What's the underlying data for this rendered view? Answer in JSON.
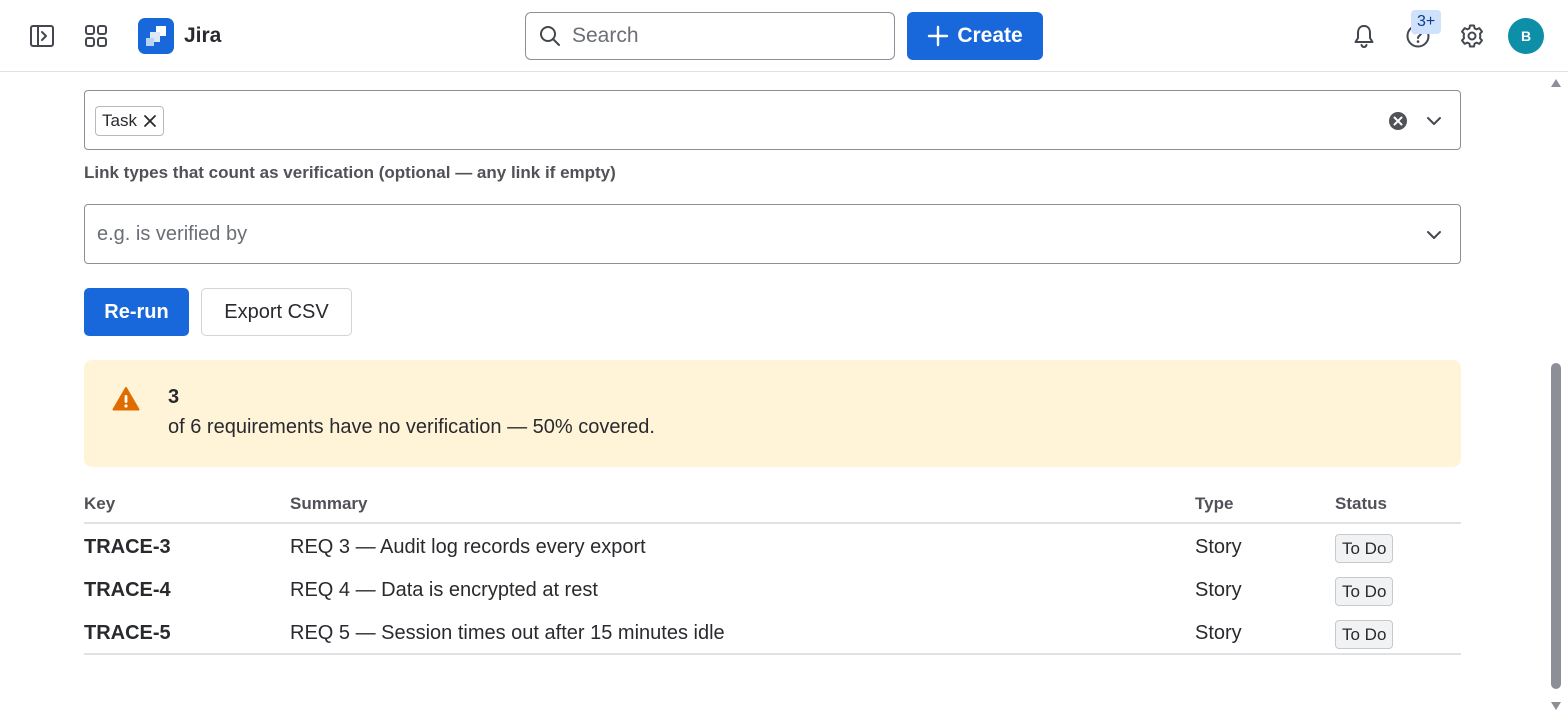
{
  "topbar": {
    "app_name": "Jira",
    "search_placeholder": "Search",
    "create_label": "Create",
    "help_badge": "3+",
    "avatar_initial": "B"
  },
  "issue_types_field": {
    "selected_tags": [
      {
        "label": "Task"
      }
    ]
  },
  "link_types_field": {
    "label": "Link types that count as verification (optional — any link if empty)",
    "placeholder": "e.g. is verified by",
    "value": ""
  },
  "actions": {
    "rerun_label": "Re-run",
    "export_label": "Export CSV"
  },
  "alert": {
    "count": "3",
    "message": "of 6 requirements have no verification — 50% covered."
  },
  "table": {
    "headers": {
      "key": "Key",
      "summary": "Summary",
      "type": "Type",
      "status": "Status"
    },
    "rows": [
      {
        "key": "TRACE-3",
        "summary": "REQ 3 — Audit log records every export",
        "type": "Story",
        "status": "To Do"
      },
      {
        "key": "TRACE-4",
        "summary": "REQ 4 — Data is encrypted at rest",
        "type": "Story",
        "status": "To Do"
      },
      {
        "key": "TRACE-5",
        "summary": "REQ 5 — Session times out after 15 minutes idle",
        "type": "Story",
        "status": "To Do"
      }
    ]
  },
  "colors": {
    "brand": "#1868db",
    "warning_bg": "#fff4d8",
    "warning_icon": "#e06c00",
    "avatar": "#0e8fa8"
  },
  "icons": {
    "sidebar_toggle": "sidebar-toggle-icon",
    "app_switcher": "app-switcher-icon",
    "search": "search-icon",
    "plus": "plus-icon",
    "notifications": "bell-icon",
    "help": "help-icon",
    "settings": "gear-icon",
    "warning": "warning-icon"
  }
}
